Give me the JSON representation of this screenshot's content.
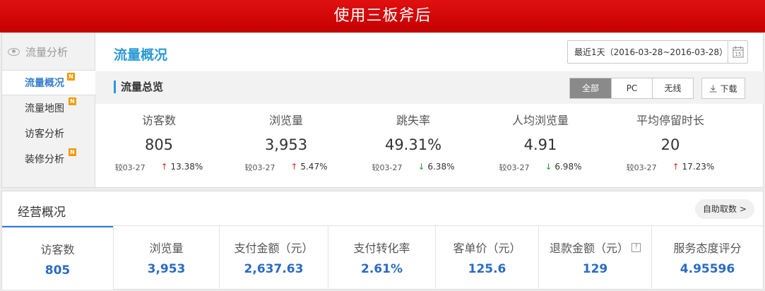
{
  "banner": {
    "title": "使用三板斧后"
  },
  "sidebar": {
    "header": "流量分析",
    "items": [
      {
        "label": "流量概况",
        "badge": "N"
      },
      {
        "label": "流量地图",
        "badge": "N"
      },
      {
        "label": "访客分析",
        "badge": ""
      },
      {
        "label": "装修分析",
        "badge": "N"
      }
    ]
  },
  "main": {
    "title": "流量概况",
    "date_range": "最近1天（2016-03-28~2016-03-28）",
    "calendar_day": "15",
    "section_title": "流量总览",
    "filters": [
      "全部",
      "PC",
      "无线"
    ],
    "download_label": "下载",
    "metrics": [
      {
        "label": "访客数",
        "value": "805",
        "compare": "较03-27",
        "change": "13.38%",
        "direction": "up"
      },
      {
        "label": "浏览量",
        "value": "3,953",
        "compare": "较03-27",
        "change": "5.47%",
        "direction": "up"
      },
      {
        "label": "跳失率",
        "value": "49.31%",
        "compare": "较03-27",
        "change": "6.38%",
        "direction": "down"
      },
      {
        "label": "人均浏览量",
        "value": "4.91",
        "compare": "较03-27",
        "change": "6.98%",
        "direction": "down"
      },
      {
        "label": "平均停留时长",
        "value": "20",
        "compare": "较03-27",
        "change": "17.23%",
        "direction": "up"
      }
    ]
  },
  "business": {
    "title": "经营概况",
    "self_service_label": "自助取数",
    "cells": [
      {
        "label": "访客数",
        "value": "805"
      },
      {
        "label": "浏览量",
        "value": "3,953"
      },
      {
        "label": "支付金额（元）",
        "value": "2,637.63"
      },
      {
        "label": "支付转化率",
        "value": "2.61%"
      },
      {
        "label": "客单价（元）",
        "value": "125.6"
      },
      {
        "label": "退款金额（元）",
        "value": "129",
        "help": "?"
      },
      {
        "label": "服务态度评分",
        "value": "4.95596"
      }
    ]
  },
  "colors": {
    "banner": "#d00000",
    "accent_blue": "#2a9bd5",
    "value_blue": "#2a6bc4",
    "up": "#e0302a",
    "down": "#2aa03a"
  }
}
